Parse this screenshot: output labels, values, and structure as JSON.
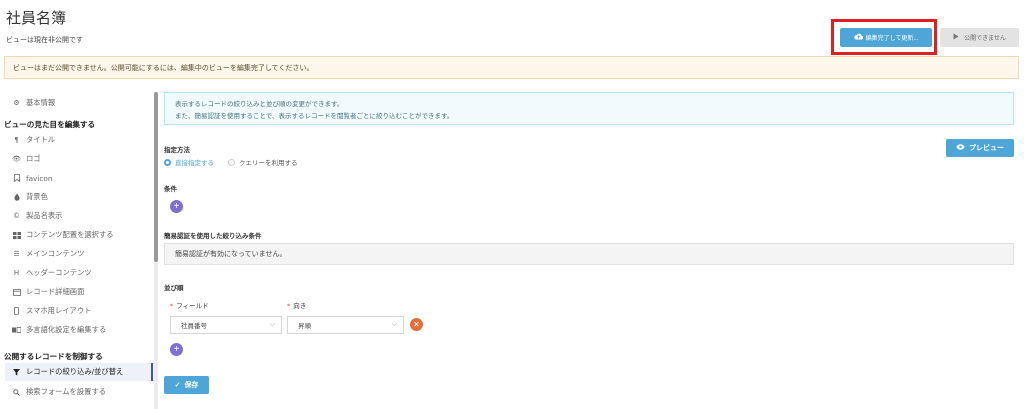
{
  "page": {
    "title": "社員名簿",
    "status": "ビューは現在非公開です"
  },
  "header": {
    "finish_label": "編集完了して更新...",
    "publish_label": "公開できません"
  },
  "alert": {
    "message": "ビューはまだ公開できません。公開可能にするには、編集中のビューを編集完了してください。"
  },
  "sidebar": {
    "basic_info": "基本情報",
    "section_appearance": "ビューの見た目を編集する",
    "appearance_items": [
      {
        "label": "タイトル",
        "icon": "paragraph-icon"
      },
      {
        "label": "ロゴ",
        "icon": "eye-icon"
      },
      {
        "label": "favicon",
        "icon": "bookmark-icon"
      },
      {
        "label": "背景色",
        "icon": "drop-icon"
      },
      {
        "label": "製品名表示",
        "icon": "copyright-icon"
      },
      {
        "label": "コンテンツ配置を選択する",
        "icon": "grid-icon"
      },
      {
        "label": "メインコンテンツ",
        "icon": "list-icon"
      },
      {
        "label": "ヘッダーコンテンツ",
        "icon": "header-icon"
      },
      {
        "label": "レコード詳細画面",
        "icon": "window-icon"
      },
      {
        "label": "スマホ用レイアウト",
        "icon": "mobile-icon"
      },
      {
        "label": "多言語化設定を編集する",
        "icon": "translate-icon"
      }
    ],
    "section_records": "公開するレコードを制御する",
    "record_items": [
      {
        "label": "レコードの絞り込み/並び替え",
        "icon": "filter-icon",
        "active": true
      },
      {
        "label": "検索フォームを設置する",
        "icon": "search-icon",
        "active": false
      }
    ]
  },
  "info": {
    "line1": "表示するレコードの絞り込みと並び順の変更ができます。",
    "line2": "また、簡易認証を使用することで、表示するレコードを閲覧者ごとに絞り込むことができます。"
  },
  "spec": {
    "label": "指定方法",
    "options": [
      "直接指定する",
      "クエリーを利用する"
    ],
    "selected": 0
  },
  "preview_label": "プレビュー",
  "conditions": {
    "label": "条件"
  },
  "auth": {
    "label": "簡易認証を使用した絞り込み条件",
    "message": "簡易認証が有効になっていません。"
  },
  "sort": {
    "label": "並び順",
    "field_label": "フィールド",
    "direction_label": "向き",
    "field_value": "社員番号",
    "direction_value": "昇順"
  },
  "save_label": "保存",
  "colors": {
    "primary": "#4ea6d8",
    "highlight": "#e02020",
    "add": "#7e6fd0",
    "remove": "#e0703a"
  }
}
